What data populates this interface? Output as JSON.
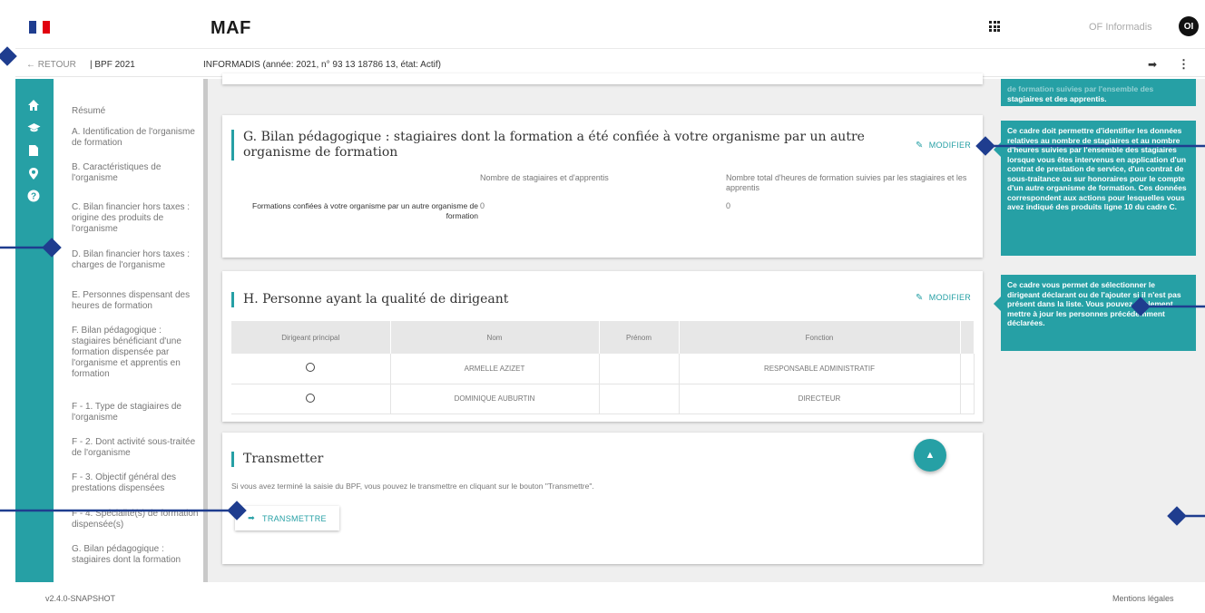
{
  "header": {
    "app_title": "MAF",
    "user_name": "OF Informadis",
    "avatar_initials": "OI"
  },
  "subbar": {
    "back_label": "← RETOUR",
    "crumb": "| BPF 2021",
    "context": "INFORMADIS (année: 2021, n° 93 13 18786 13, état: Actif)"
  },
  "sidebar": {
    "icons": [
      "home-icon",
      "graduation-cap-icon",
      "document-icon",
      "location-pin-icon",
      "help-icon"
    ],
    "items": [
      "Résumé",
      "A. Identification de l'organisme de formation",
      "B. Caractéristiques de l'organisme",
      "C. Bilan financier hors taxes : origine des produits de l'organisme",
      "D. Bilan financier hors taxes : charges de l'organisme",
      "E. Personnes dispensant des heures de formation",
      "F. Bilan pédagogique : stagiaires bénéficiant d'une formation dispensée par l'organisme et apprentis en formation",
      "F - 1. Type de stagiaires de l'organisme",
      "F - 2. Dont activité sous-traitée de l'organisme",
      "F - 3. Objectif général des prestations dispensées",
      "F - 4. Spécialité(s) de formation dispensée(s)",
      "G. Bilan pédagogique : stagiaires dont la formation"
    ]
  },
  "section_g": {
    "title": "G. Bilan pédagogique : stagiaires dont la formation a été confiée à votre organisme par un autre organisme de formation",
    "modify_label": "MODIFIER",
    "col1_header": "Nombre de stagiaires et d'apprentis",
    "col2_header": "Nombre total d'heures de formation suivies par les stagiaires et les apprentis",
    "row_label": "Formations confiées à votre organisme par un autre organisme de formation",
    "row_val1": "0",
    "row_val2": "0"
  },
  "section_h": {
    "title": "H. Personne ayant la qualité de dirigeant",
    "modify_label": "MODIFIER",
    "columns": [
      "Dirigeant principal",
      "Nom",
      "Prénom",
      "Fonction"
    ],
    "rows": [
      {
        "nom": "ARMELLE AZIZET",
        "prenom": "",
        "fonction": "RESPONSABLE ADMINISTRATIF"
      },
      {
        "nom": "DOMINIQUE AUBURTIN",
        "prenom": "",
        "fonction": "DIRECTEUR"
      }
    ]
  },
  "transmettre": {
    "title": "Transmetter",
    "description": "Si vous avez terminé la saisie du BPF, vous pouvez le transmettre en cliquant sur le bouton \"Transmettre\".",
    "button_label": "TRANSMETTRE"
  },
  "tips": {
    "top": "stagiaires et des apprentis.",
    "top_partial": "de formation suivies par l'ensemble des",
    "g": "Ce cadre doit permettre d'identifier les données relatives au nombre de stagiaires et au nombre d'heures suivies par l'ensemble des stagiaires lorsque vous êtes intervenus en application d'un contrat de prestation de service, d'un contrat de sous-traitance ou sur honoraires pour le compte d'un autre organisme de formation. Ces données correspondent aux actions pour lesquelles vous avez indiqué des produits ligne 10 du cadre C.",
    "h": "Ce cadre vous permet de sélectionner le dirigeant déclarant ou de l'ajouter si il n'est pas présent dans la liste. Vous pouvez également mettre à jour les personnes précédemment déclarées."
  },
  "footer": {
    "version": "v2.4.0-SNAPSHOT",
    "legal": "Mentions légales"
  },
  "colors": {
    "accent": "#26a0a5",
    "callout": "#1f3d8f"
  }
}
